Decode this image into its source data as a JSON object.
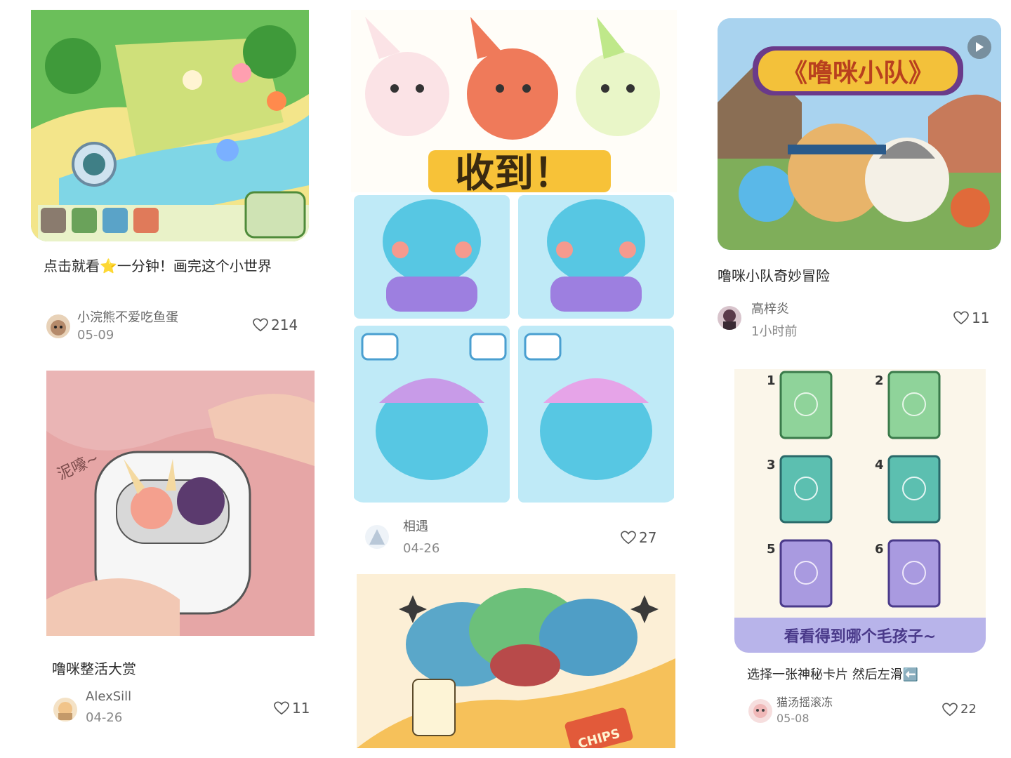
{
  "cards": [
    {
      "title": "点击就看⭐一分钟！画完这个小世界",
      "author": "小浣熊不爱吃鱼蛋",
      "date": "05-09",
      "likes": "214"
    },
    {
      "title": "",
      "author": "相遇",
      "date": "04-26",
      "likes": "27",
      "image_text": "收到！"
    },
    {
      "title": "噜咪小队奇妙冒险",
      "author": "高梓炎",
      "date": "1小时前",
      "likes": "11",
      "image_text": "《噜咪小队》"
    },
    {
      "title": "噜咪整活大赏",
      "author": "AlexSill",
      "date": "04-26",
      "likes": "11",
      "image_text": "泥嚎~"
    },
    {
      "title": "",
      "author": "",
      "date": "",
      "likes": "",
      "image_text": "CHIPS"
    },
    {
      "title": "选择一张神秘卡片 然后左滑⬅️",
      "author": "猫汤摇滚冻",
      "date": "05-08",
      "likes": "22",
      "image_text": "看看得到哪个毛孩子~",
      "card_numbers": [
        "1",
        "2",
        "3",
        "4",
        "5",
        "6"
      ]
    }
  ],
  "icons": [
    "heart-icon",
    "play-icon",
    "avatar"
  ]
}
